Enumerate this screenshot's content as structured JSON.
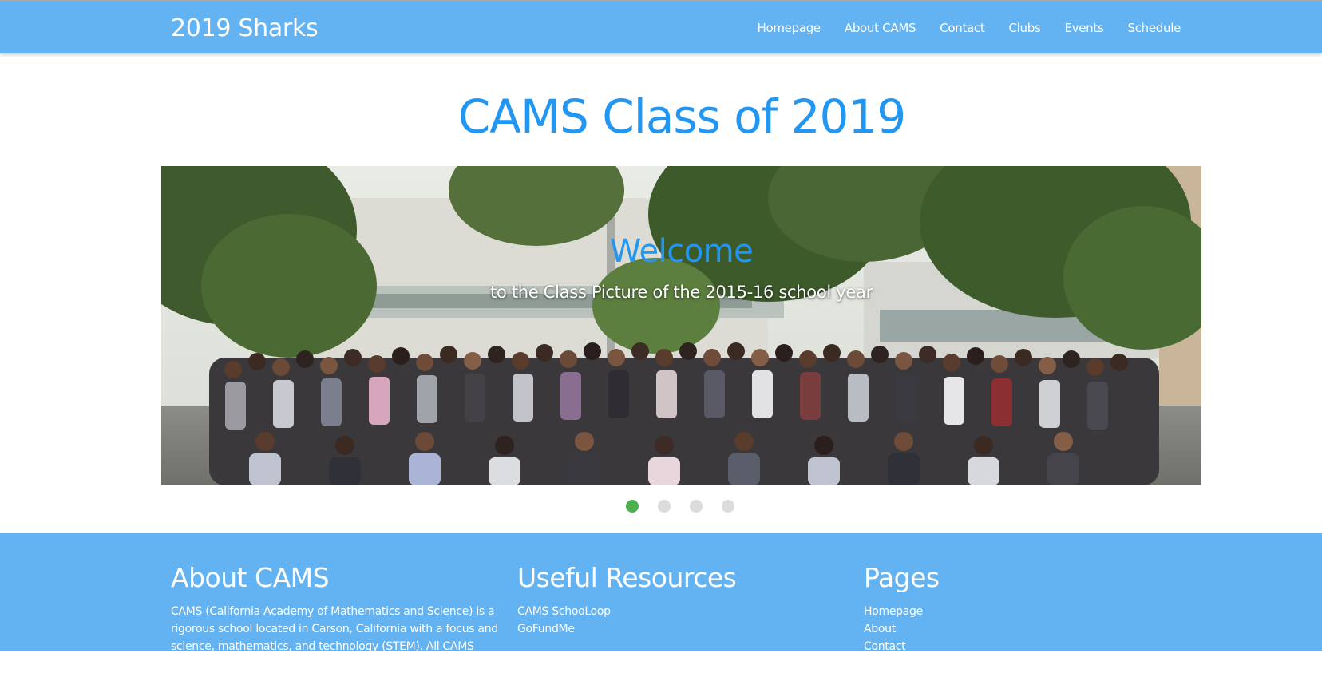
{
  "navbar": {
    "brand": "2019 Sharks",
    "links": [
      "Homepage",
      "About CAMS",
      "Contact",
      "Clubs",
      "Events",
      "Schedule"
    ]
  },
  "main": {
    "title": "CAMS Class of 2019"
  },
  "carousel": {
    "caption_title": "Welcome",
    "caption_subtitle": "to the Class Picture of the 2015-16 school year",
    "slide_count": 4,
    "active_index": 0,
    "active_color": "#4caf50",
    "inactive_color": "#dcdcdc"
  },
  "footer": {
    "about": {
      "heading": "About CAMS",
      "text": "CAMS (California Academy of Mathematics and Science) is a rigorous school located in Carson, California with a focus and science, mathematics, and technology (STEM). All CAMS students"
    },
    "resources": {
      "heading": "Useful Resources",
      "links": [
        "CAMS SchooLoop",
        "GoFundMe"
      ]
    },
    "pages": {
      "heading": "Pages",
      "links": [
        "Homepage",
        "About",
        "Contact"
      ]
    }
  },
  "colors": {
    "navbar_bg": "#63b3f3",
    "title_blue": "#2196f3",
    "footer_bg": "#63b3f3"
  }
}
